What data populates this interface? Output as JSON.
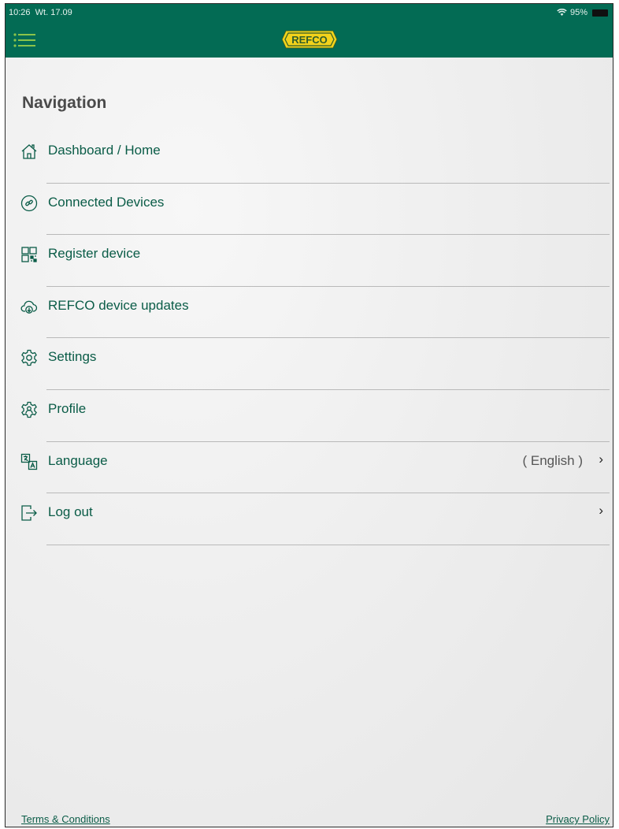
{
  "status_bar": {
    "time": "10:26",
    "date": "Wt. 17.09",
    "battery": "95%"
  },
  "header": {
    "logo_text": "REFCO",
    "menu_icon": "hamburger-list-icon",
    "colors": {
      "bar": "#036b54",
      "logo": "#f2d21b"
    }
  },
  "navigation": {
    "title": "Navigation",
    "items": [
      {
        "label": "Dashboard / Home",
        "icon": "home-icon"
      },
      {
        "label": "Connected Devices",
        "icon": "link-icon"
      },
      {
        "label": "Register device",
        "icon": "qr-code-icon"
      },
      {
        "label": "REFCO device updates",
        "icon": "cloud-download-icon"
      },
      {
        "label": "Settings",
        "icon": "gear-icon"
      },
      {
        "label": "Profile",
        "icon": "profile-gear-icon"
      },
      {
        "label": "Language",
        "icon": "translate-icon",
        "value": "( English )",
        "chevron": "›"
      },
      {
        "label": "Log out",
        "icon": "logout-icon",
        "chevron": "›"
      }
    ]
  },
  "footer": {
    "terms": "Terms & Conditions",
    "privacy": "Privacy Policy"
  },
  "colors": {
    "accent": "#0a5c47",
    "divider": "#b9b9b9"
  }
}
